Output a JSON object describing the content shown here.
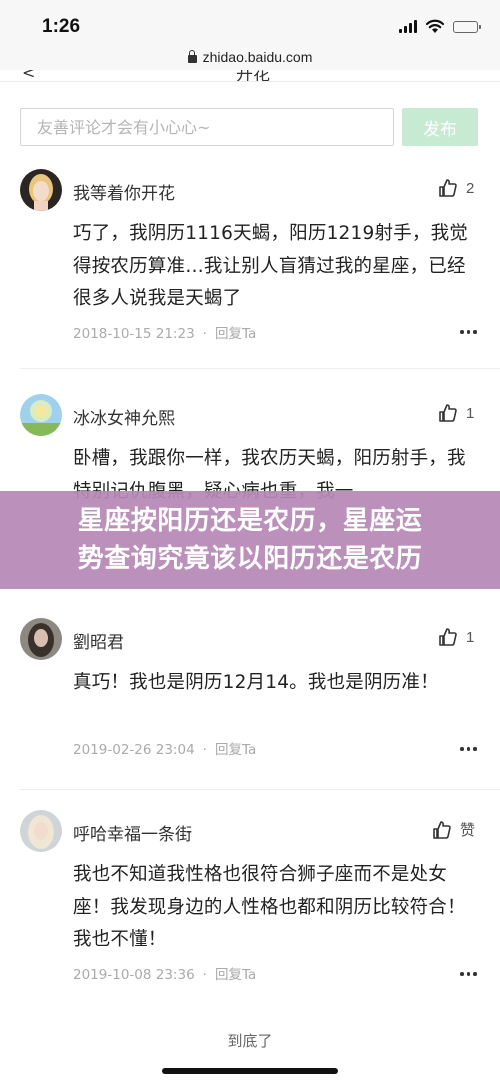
{
  "status_bar": {
    "time": "1:26"
  },
  "browser": {
    "url": "zhidao.baidu.com"
  },
  "header": {
    "title_fragment": "开花"
  },
  "comment_box": {
    "placeholder": "友善评论才会有小心心~",
    "publish_label": "发布"
  },
  "comments": [
    {
      "username": "我等着你开花",
      "likes": "2",
      "body": "巧了，我阴历1116天蝎，阳历1219射手，我觉得按农历算准…我让别人盲猜过我的星座，已经很多人说我是天蝎了",
      "date": "2018-10-15 21:23",
      "reply": "回复Ta"
    },
    {
      "username": "冰冰女神允熙",
      "likes": "1",
      "body": "卧槽，我跟你一样，我农历天蝎，阳历射手，我特别记仇腹黑，疑心病也重，我一",
      "date": "",
      "reply": ""
    },
    {
      "username": "劉昭君",
      "likes": "1",
      "body": "真巧！我也是阴历12月14。我也是阴历准！",
      "date": "2019-02-26 23:04",
      "reply": "回复Ta"
    },
    {
      "username": "呼哈幸福一条街",
      "likes": "赞",
      "body": "我也不知道我性格也很符合狮子座而不是处女座！我发现身边的人性格也都和阴历比较符合！我也不懂！",
      "date": "2019-10-08 23:36",
      "reply": "回复Ta"
    }
  ],
  "banner": {
    "line1": "星座按阳历还是农历，星座运",
    "line2": "势查询究竟该以阳历还是农历"
  },
  "footer": {
    "end_text": "到底了"
  },
  "colors": {
    "publish_bg": "#c7ead3",
    "banner_bg": "#b689b6",
    "meta_text": "#aaaaaa"
  }
}
